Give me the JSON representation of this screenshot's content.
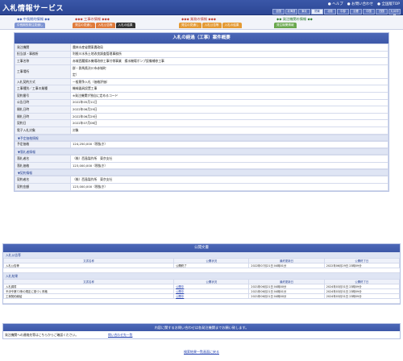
{
  "header": {
    "title": "入札情報サービス",
    "links": [
      "ヘルプ",
      "お問い合わせ",
      "全国版TOP"
    ],
    "regions": [
      "全国",
      "北海道",
      "東北",
      "関東",
      "北陸",
      "中部",
      "近畿",
      "中国",
      "四国",
      "九州沖縄"
    ],
    "selected_region": "関東"
  },
  "categories": [
    {
      "title": "中長期的情報",
      "tabs": [
        "中長期的発注見通し"
      ]
    },
    {
      "title": "工事の情報",
      "tabs": [
        "発注の見通し",
        "入札公告等",
        "入札の結果"
      ],
      "active": "入札の結果"
    },
    {
      "title": "業務の情報",
      "tabs": [
        "発注の見通し",
        "入札公告等",
        "入札の結果"
      ]
    },
    {
      "title": "発注機関の情報",
      "tabs": [
        "発注機関情報"
      ]
    }
  ],
  "detail": {
    "title": "入札の経過（工事）案件概要",
    "rows": [
      {
        "label": "発注機関",
        "value": "農林水産省関東農政局"
      },
      {
        "label": "担当部・事務所",
        "value": "利根川水系土地改良調査管理事務所"
      },
      {
        "label": "工事名称",
        "value": "赤城西麓揚水機場改修工事付帯事業　揚水機場ポンプ設備補修工事"
      }
    ],
    "place": {
      "label": "工事場所",
      "lines": [
        "群・群馬県渋川市赤城町",
        "定）"
      ]
    },
    "rows2": [
      {
        "label": "入札契約方式",
        "value": "一般競争入札（価格評価）"
      },
      {
        "label": "工事種別／工事の業種",
        "value": "機械器具設置工事"
      },
      {
        "label": "契約番号",
        "value": "※発注機関が独自に定めるコード"
      },
      {
        "label": "公告日時",
        "value": "2022年05月11日"
      },
      {
        "label": "開札日時",
        "value": "2022年06月29日"
      },
      {
        "label": "開札日時",
        "value": "2022年06月29日"
      },
      {
        "label": "契約日",
        "value": "2022年07月06日"
      },
      {
        "label": "電子入札対象",
        "value": "対象"
      }
    ],
    "sec_price": "予定価格情報",
    "price": {
      "label": "予定価格",
      "value": "124,250,000（税抜き）"
    },
    "sec_winner": "落札者情報",
    "winner": [
      {
        "label": "落札者名",
        "value": "（株）西島製作所　東京支社"
      },
      {
        "label": "落札価格",
        "value": "123,000,000（税抜き）"
      }
    ],
    "sec_contract": "契約情報",
    "contract": [
      {
        "label": "契約者名",
        "value": "（株）西島製作所　東京支社"
      },
      {
        "label": "契約金額",
        "value": "123,000,000（税抜き）"
      }
    ]
  },
  "docs": {
    "title": "公開文書",
    "sec1": "入札公告等",
    "headers": [
      "文書名称",
      "公開状況",
      "最終更新日",
      "公開終了日"
    ],
    "notice_rows": [
      {
        "name": "入札公告等",
        "status": "公開終了",
        "updated": "2022年07月21日 04時01分",
        "end": "2022年06月29日 23時59分"
      }
    ],
    "sec2": "入札結果",
    "result_rows": [
      {
        "name": "入札調書",
        "status": "公開中",
        "updated": "2021年06月21日 04時00分",
        "end": "2024年03月31日 23時59分"
      },
      {
        "name": "予決令第72条の規定に基づく資格",
        "status": "公開中",
        "updated": "2021年06月21日 04時01分",
        "end": "2024年03月31日 23時59分"
      },
      {
        "name": "工事契約締結",
        "status": "公開中",
        "updated": "2021年06月21日 04時00分",
        "end": "2024年03月31日 23時59分"
      }
    ]
  },
  "contact": {
    "title": "内容に関するお問い合わせは各発注機関までお願い致します。",
    "text": "発注機関への連絡先等はこちらからご確認ください。",
    "link": "問い合わせ先一覧"
  },
  "back_link": "検索結果一覧画面に戻る"
}
